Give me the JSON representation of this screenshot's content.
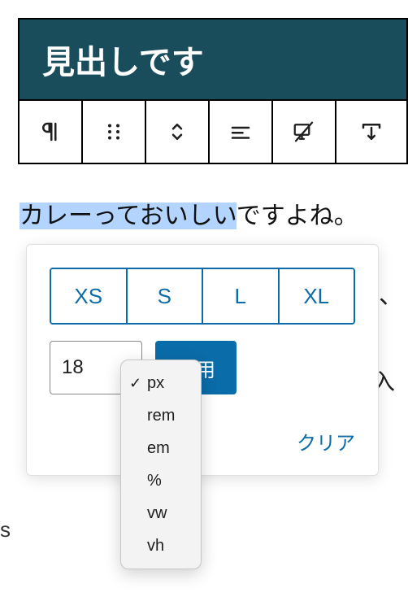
{
  "heading": {
    "text": "見出しです"
  },
  "toolbar": {
    "items": [
      {
        "name": "paragraph-icon"
      },
      {
        "name": "drag-handle-icon"
      },
      {
        "name": "move-updown-icon"
      },
      {
        "name": "align-icon"
      },
      {
        "name": "device-icon"
      },
      {
        "name": "height-icon"
      }
    ]
  },
  "paragraph": {
    "selected": "カレーっておいしい",
    "rest": "ですよね。"
  },
  "popover": {
    "presets": [
      "XS",
      "S",
      "L",
      "XL"
    ],
    "size_value": "18",
    "apply_label": "適用",
    "clear_label": "クリア"
  },
  "unit_dropdown": {
    "selected": "px",
    "options": [
      "px",
      "rem",
      "em",
      "%",
      "vw",
      "vh"
    ]
  },
  "background_text": {
    "comma": "、",
    "wo": "を入",
    "s": "s"
  }
}
